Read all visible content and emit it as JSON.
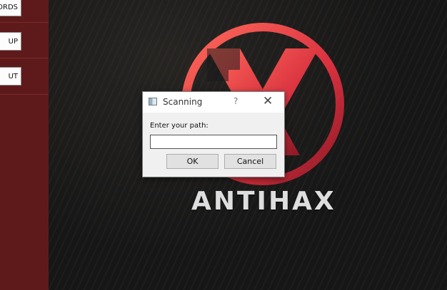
{
  "sidebar": {
    "buttons": [
      {
        "label": "ORDS"
      },
      {
        "label": "UP"
      },
      {
        "label": "UT"
      }
    ]
  },
  "brand": {
    "name": "ANTIHAX"
  },
  "dialog": {
    "title": "Scanning",
    "help": "?",
    "close": "✕",
    "prompt": "Enter your path:",
    "input_value": "",
    "ok_label": "OK",
    "cancel_label": "Cancel"
  },
  "colors": {
    "sidebar": "#5e1a1a",
    "logo_red": "#e0404a",
    "background": "#161616"
  }
}
